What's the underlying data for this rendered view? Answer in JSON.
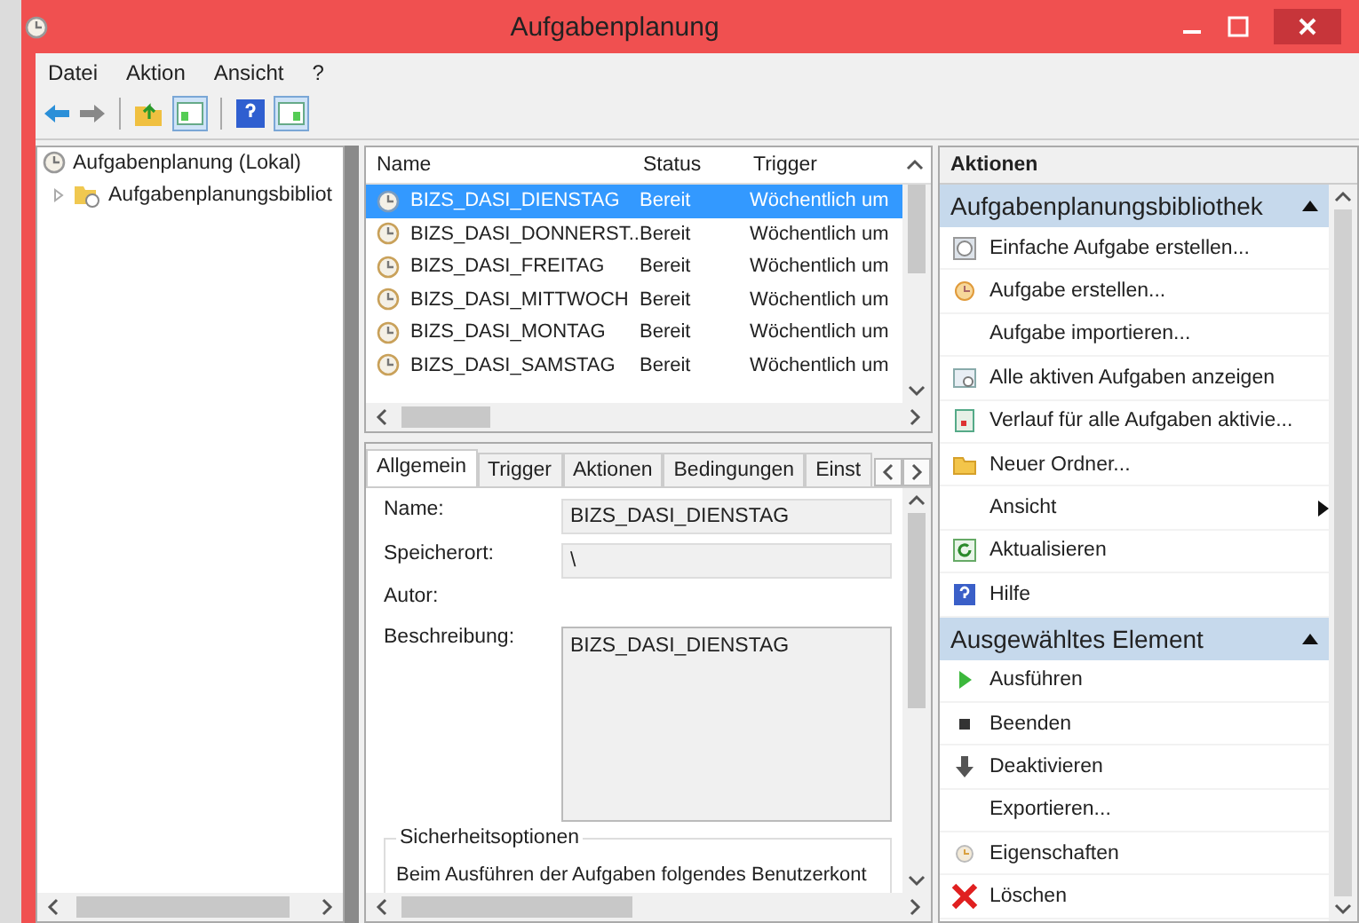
{
  "window": {
    "title": "Aufgabenplanung"
  },
  "menu": [
    "Datei",
    "Aktion",
    "Ansicht",
    "?"
  ],
  "tree": {
    "label": "Aufgabenplanung (Lokal)",
    "children": [
      {
        "label": "Aufgabenplanungsbibliot",
        "expanded": false
      }
    ]
  },
  "task_list": {
    "columns": [
      "Name",
      "Status",
      "Trigger"
    ],
    "rows": [
      {
        "name": "BIZS_DASI_DIENSTAG",
        "status": "Bereit",
        "trigger": "Wöchentlich um",
        "selected": true
      },
      {
        "name": "BIZS_DASI_DONNERST...",
        "status": "Bereit",
        "trigger": "Wöchentlich um",
        "selected": false
      },
      {
        "name": "BIZS_DASI_FREITAG",
        "status": "Bereit",
        "trigger": "Wöchentlich um",
        "selected": false
      },
      {
        "name": "BIZS_DASI_MITTWOCH",
        "status": "Bereit",
        "trigger": "Wöchentlich um",
        "selected": false
      },
      {
        "name": "BIZS_DASI_MONTAG",
        "status": "Bereit",
        "trigger": "Wöchentlich um",
        "selected": false
      },
      {
        "name": "BIZS_DASI_SAMSTAG",
        "status": "Bereit",
        "trigger": "Wöchentlich um",
        "selected": false
      }
    ]
  },
  "details": {
    "tabs": [
      {
        "label": "Allgemein",
        "selected": true
      },
      {
        "label": "Trigger",
        "selected": false
      },
      {
        "label": "Aktionen",
        "selected": false
      },
      {
        "label": "Bedingungen",
        "selected": false
      },
      {
        "label": "Einst",
        "selected": false
      }
    ],
    "fields": [
      {
        "label": "Name:",
        "kind": "field",
        "value": "BIZS_DASI_DIENSTAG"
      },
      {
        "label": "Speicherort:",
        "kind": "field",
        "value": "\\"
      },
      {
        "label": "Autor:",
        "kind": "text"
      },
      {
        "label": "Beschreibung:",
        "kind": "area",
        "value": "BIZS_DASI_DIENSTAG"
      }
    ],
    "security": {
      "title": "Sicherheitsoptionen",
      "text": "Beim Ausführen der Aufgaben folgendes Benutzerkont"
    }
  },
  "actions": {
    "title": "Aktionen",
    "sections": [
      {
        "title": "Aufgabenplanungsbibliothek",
        "expanded": true,
        "items": [
          {
            "label": "Einfache Aufgabe erstellen...",
            "kind": "action"
          },
          {
            "label": "Aufgabe erstellen...",
            "kind": "action"
          },
          {
            "label": "Aufgabe importieren...",
            "kind": "action"
          },
          {
            "label": "Alle aktiven Aufgaben anzeigen",
            "kind": "action"
          },
          {
            "label": "Verlauf für alle Aufgaben aktivie...",
            "kind": "action"
          },
          {
            "label": "Neuer Ordner...",
            "kind": "action"
          },
          {
            "label": "Ansicht",
            "kind": "submenu"
          },
          {
            "label": "Aktualisieren",
            "kind": "action"
          },
          {
            "label": "Hilfe",
            "kind": "action"
          }
        ]
      },
      {
        "title": "Ausgewähltes Element",
        "expanded": true,
        "items": [
          {
            "label": "Ausführen",
            "kind": "action"
          },
          {
            "label": "Beenden",
            "kind": "action"
          },
          {
            "label": "Deaktivieren",
            "kind": "action"
          },
          {
            "label": "Exportieren...",
            "kind": "action"
          },
          {
            "label": "Eigenschaften",
            "kind": "action"
          },
          {
            "label": "Löschen",
            "kind": "action"
          }
        ]
      }
    ]
  }
}
